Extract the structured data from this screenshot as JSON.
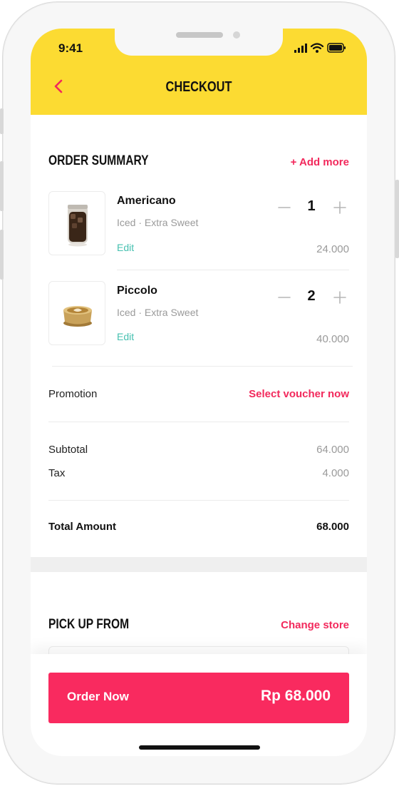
{
  "status_bar": {
    "time": "9:41"
  },
  "header": {
    "title": "CHECKOUT",
    "back_icon": "chevron-left-icon"
  },
  "order_summary": {
    "title": "ORDER SUMMARY",
    "add_more": "+ Add more",
    "items": [
      {
        "name": "Americano",
        "options": "Iced · Extra Sweet",
        "edit": "Edit",
        "quantity": "1",
        "price": "24.000",
        "image": "iced-americano-image"
      },
      {
        "name": "Piccolo",
        "options": "Iced · Extra Sweet",
        "edit": "Edit",
        "quantity": "2",
        "price": "40.000",
        "image": "piccolo-cup-image"
      }
    ]
  },
  "promotion": {
    "label": "Promotion",
    "action": "Select voucher now"
  },
  "totals": {
    "subtotal_label": "Subtotal",
    "subtotal": "64.000",
    "tax_label": "Tax",
    "tax": "4.000",
    "total_label": "Total Amount",
    "total": "68.000"
  },
  "pickup": {
    "title": "PICK UP FROM",
    "action": "Change store"
  },
  "footer": {
    "order_label": "Order Now",
    "order_total": "Rp 68.000"
  },
  "colors": {
    "header": "#fcdb32",
    "accent": "#f2295c",
    "button": "#f92a5f",
    "edit": "#46c0b0"
  }
}
